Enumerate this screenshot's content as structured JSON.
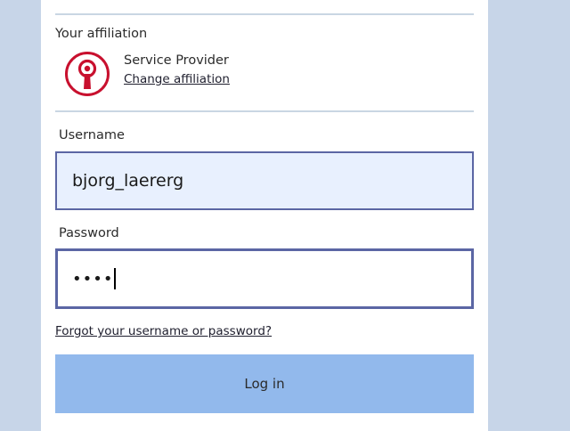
{
  "affiliation": {
    "heading": "Your affiliation",
    "name": "Service Provider",
    "change_link": "Change affiliation"
  },
  "username": {
    "label": "Username",
    "value": "bjorg_laererg"
  },
  "password": {
    "label": "Password",
    "masked_value": "••••"
  },
  "forgot_link": "Forgot your username or password?",
  "login_button": "Log in",
  "colors": {
    "background": "#c7d5e8",
    "logo_red": "#c8102e",
    "input_border": "#5b66a4",
    "button": "#92b9ec"
  }
}
